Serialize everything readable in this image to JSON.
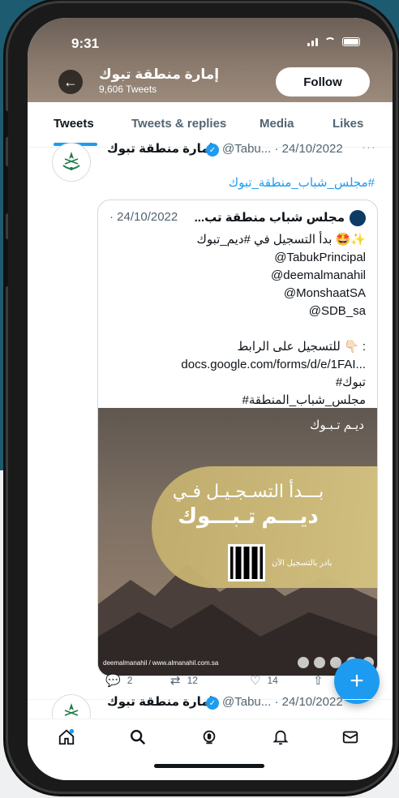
{
  "status_bar": {
    "time": "9:31"
  },
  "header": {
    "back_icon": "arrow-left-icon",
    "profile_name": "إمارة منطقة تبوك",
    "tweet_count": "9,606 Tweets",
    "follow_label": "Follow"
  },
  "tabs": [
    {
      "label": "Tweets",
      "active": true
    },
    {
      "label": "Tweets & replies"
    },
    {
      "label": "Media"
    },
    {
      "label": "Likes"
    }
  ],
  "tweet": {
    "name": "إمارة منطقة تبوك",
    "handle": "@Tabu...",
    "date": "· 24/10/2022",
    "more": "···",
    "hashtag": "#مجلس_شباب_منطقة_تبوك",
    "quote": {
      "name": "مجلس شباب منطقة تب...",
      "date": "· 24/10/2022",
      "lines": [
        "بدأ التسجيل في #ديم_تبوك 🤩✨",
        "@TabukPrincipal",
        "@deemalmanahil",
        "@MonshaatSA",
        "@SDB_sa",
        "",
        "للتسجيل على الرابط 👇🏻 :",
        "docs.google.com/forms/d/e/1FAI...",
        "#تبوك",
        "#مجلس_شباب_المنطقة"
      ],
      "image": {
        "top_text": "ديـم تـبـوك",
        "sub_text": "بـــدأ التسـجـيـل فـي",
        "main_text": "ديـــم تـبـــوك",
        "qr_caption": "بادر بالتسجيل الآن",
        "footer_text": "deemalmanahil / www.almanahil.com.sa"
      }
    },
    "actions": {
      "reply_count": "2",
      "retweet_count": "12",
      "like_count": "14"
    }
  },
  "next_tweet": {
    "name": "إمارة منطقة تبوك",
    "handle": "@Tabu...",
    "date": "· 24/10/2022"
  },
  "fab": {
    "label": "+"
  },
  "bottom_nav": [
    "home-icon",
    "search-icon",
    "spaces-icon",
    "notifications-icon",
    "messages-icon"
  ],
  "colors": {
    "accent": "#1d9bf0",
    "text": "#0f1419",
    "muted": "#536471"
  }
}
